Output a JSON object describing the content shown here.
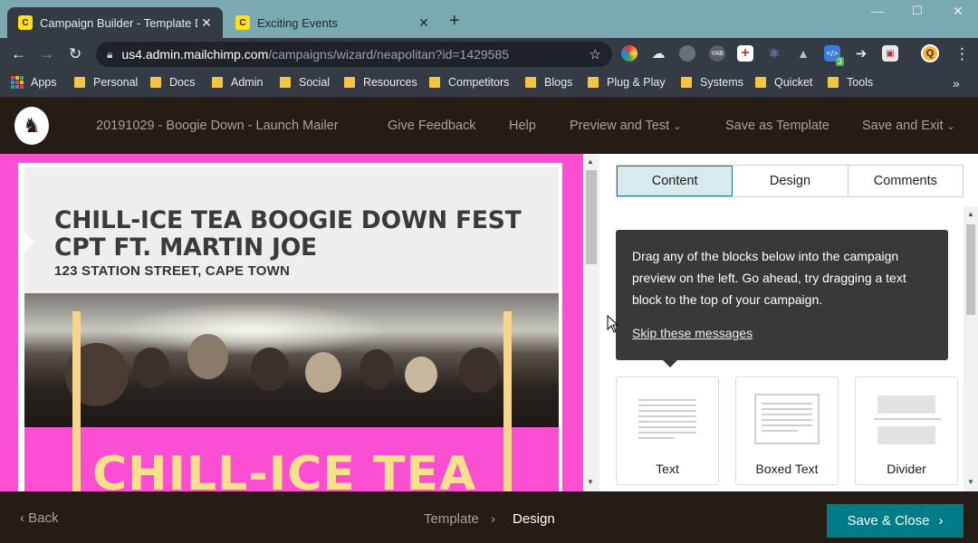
{
  "browser": {
    "tabs": [
      {
        "title": "Campaign Builder - Template Desi",
        "active": true
      },
      {
        "title": "Exciting Events",
        "active": false
      }
    ],
    "url_host": "us4.admin.mailchimp.com",
    "url_path": "/campaigns/wizard/neapolitan?id=1429585",
    "extension_badge": "3",
    "profile_initial": "Q",
    "bookmarks": [
      "Apps",
      "Personal",
      "Docs",
      "Admin",
      "Social",
      "Resources",
      "Competitors",
      "Blogs",
      "Plug & Play",
      "Systems",
      "Quicket",
      "Tools"
    ]
  },
  "mc_header": {
    "campaign_name": "20191029 - Boogie Down - Launch Mailer",
    "feedback": "Give Feedback",
    "help": "Help",
    "preview": "Preview and Test",
    "save_template": "Save as Template",
    "save_exit": "Save and Exit"
  },
  "email": {
    "title": "CHILL-ICE TEA BOOGIE DOWN FEST CPT FT. MARTIN JOE",
    "address": "123 STATION STREET, CAPE TOWN",
    "banner_text": "CHILL-ICE TEA"
  },
  "panel": {
    "tabs": [
      "Content",
      "Design",
      "Comments"
    ],
    "tip_text": "Drag any of the blocks below into the campaign preview on the left. Go ahead, try dragging a text block to the top of your campaign.",
    "skip": "Skip these messages",
    "blocks": [
      "Text",
      "Boxed Text",
      "Divider"
    ]
  },
  "footer": {
    "back": "Back",
    "crumb_template": "Template",
    "crumb_design": "Design",
    "save_close": "Save & Close"
  },
  "colors": {
    "brand_dark": "#241c15",
    "accent_teal": "#007c89",
    "preview_pink": "#fb4ed3"
  }
}
